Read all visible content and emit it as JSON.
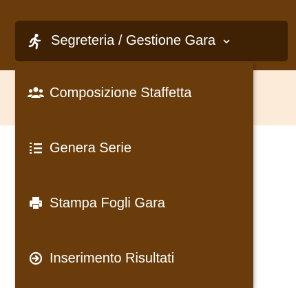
{
  "navbar": {
    "dropdown": {
      "label": "Segreteria / Gestione Gara",
      "icon": "running-icon",
      "caret_icon": "chevron-down-icon"
    }
  },
  "menu": {
    "items": [
      {
        "label": "Composizione Staffetta",
        "icon": "users-icon"
      },
      {
        "label": "Genera Serie",
        "icon": "list-ol-icon"
      },
      {
        "label": "Stampa Fogli Gara",
        "icon": "print-icon"
      },
      {
        "label": "Inserimento Risultati",
        "icon": "arrow-circle-right-icon"
      }
    ]
  },
  "colors": {
    "navbar": "#6a3c0b",
    "toggle_bg": "#3f2104",
    "menu_bg": "#6a3c0b",
    "content_band": "#fcebd9",
    "text": "#ffffff"
  }
}
